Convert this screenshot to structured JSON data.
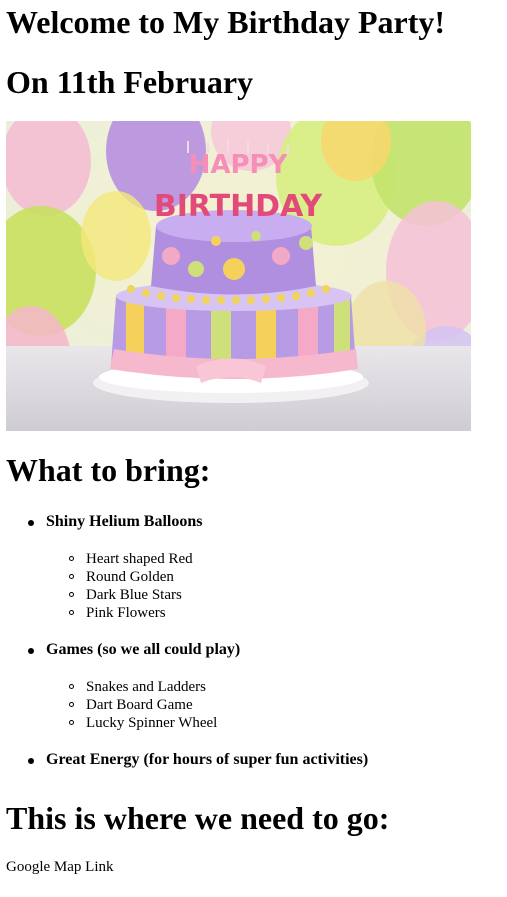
{
  "header": {
    "title": "Welcome to My Birthday Party!",
    "date": "On 11th February"
  },
  "hero": {
    "alt": "Happy Birthday cake",
    "cake_text_top": "HAPPY",
    "cake_text_bottom": "BIRTHDAY"
  },
  "bring": {
    "heading": "What to bring:",
    "items": [
      {
        "title": "Shiny Helium Balloons",
        "subitems": [
          "Heart shaped Red",
          "Round Golden",
          "Dark Blue Stars",
          "Pink Flowers"
        ]
      },
      {
        "title": "Games (so we all could play)",
        "subitems": [
          "Snakes and Ladders",
          "Dart Board Game",
          "Lucky Spinner Wheel"
        ]
      },
      {
        "title": "Great Energy (for hours of super fun activities)"
      }
    ]
  },
  "location": {
    "heading": "This is where we need to go:",
    "link_text": "Google Map Link"
  }
}
